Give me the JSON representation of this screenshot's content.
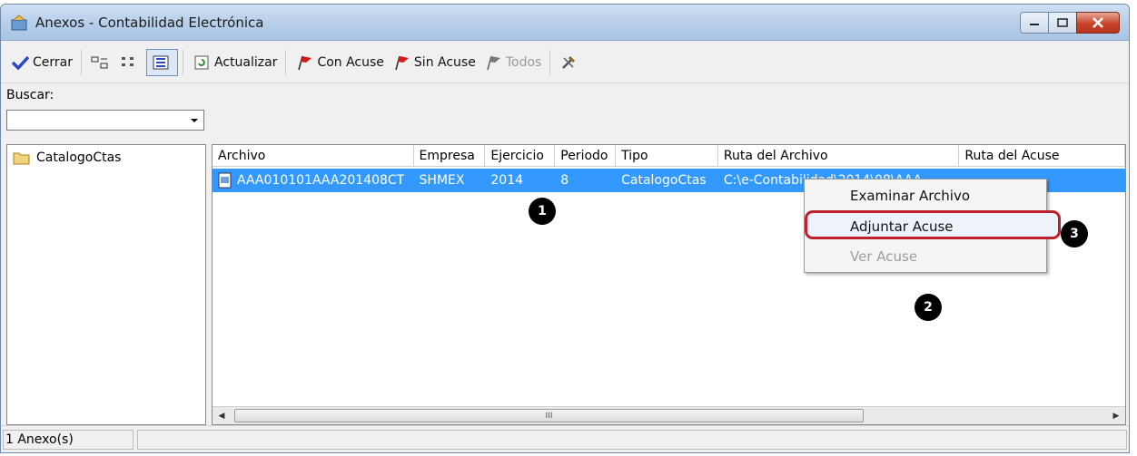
{
  "window": {
    "title": "Anexos - Contabilidad Electrónica",
    "controls": {
      "minimize": "—",
      "maximize": "□",
      "close": "✕"
    }
  },
  "toolbar": {
    "close_label": "Cerrar",
    "refresh_label": "Actualizar",
    "con_acuse_label": "Con Acuse",
    "sin_acuse_label": "Sin Acuse",
    "todos_label": "Todos"
  },
  "search": {
    "label": "Buscar:",
    "value": ""
  },
  "tree": {
    "items": [
      {
        "label": "CatalogoCtas",
        "icon": "folder-icon"
      }
    ]
  },
  "table": {
    "columns": [
      "Archivo",
      "Empresa",
      "Ejercicio",
      "Periodo",
      "Tipo",
      "Ruta del Archivo",
      "Ruta del Acuse"
    ],
    "rows": [
      {
        "archivo": "AAA010101AAA201408CT",
        "empresa": "SHMEX",
        "ejercicio": "2014",
        "periodo": "8",
        "tipo": "CatalogoCtas",
        "ruta_archivo": "C:\\e-Contabilidad\\2014\\08\\AAA",
        "ruta_acuse": ""
      }
    ]
  },
  "scrollbar": {
    "thumb_grip": "III",
    "left_arrow": "◀",
    "right_arrow": "▶"
  },
  "context_menu": {
    "items": [
      {
        "label": "Examinar Archivo",
        "enabled": true
      },
      {
        "label": "Adjuntar Acuse",
        "enabled": true,
        "highlighted": true
      },
      {
        "label": "Ver Acuse",
        "enabled": false
      }
    ]
  },
  "callouts": [
    "1",
    "2",
    "3"
  ],
  "status": {
    "text": "1 Anexo(s)"
  },
  "colors": {
    "selection": "#3399ff",
    "highlight_border": "#c0202a",
    "titlebar": "#b6cee9"
  }
}
